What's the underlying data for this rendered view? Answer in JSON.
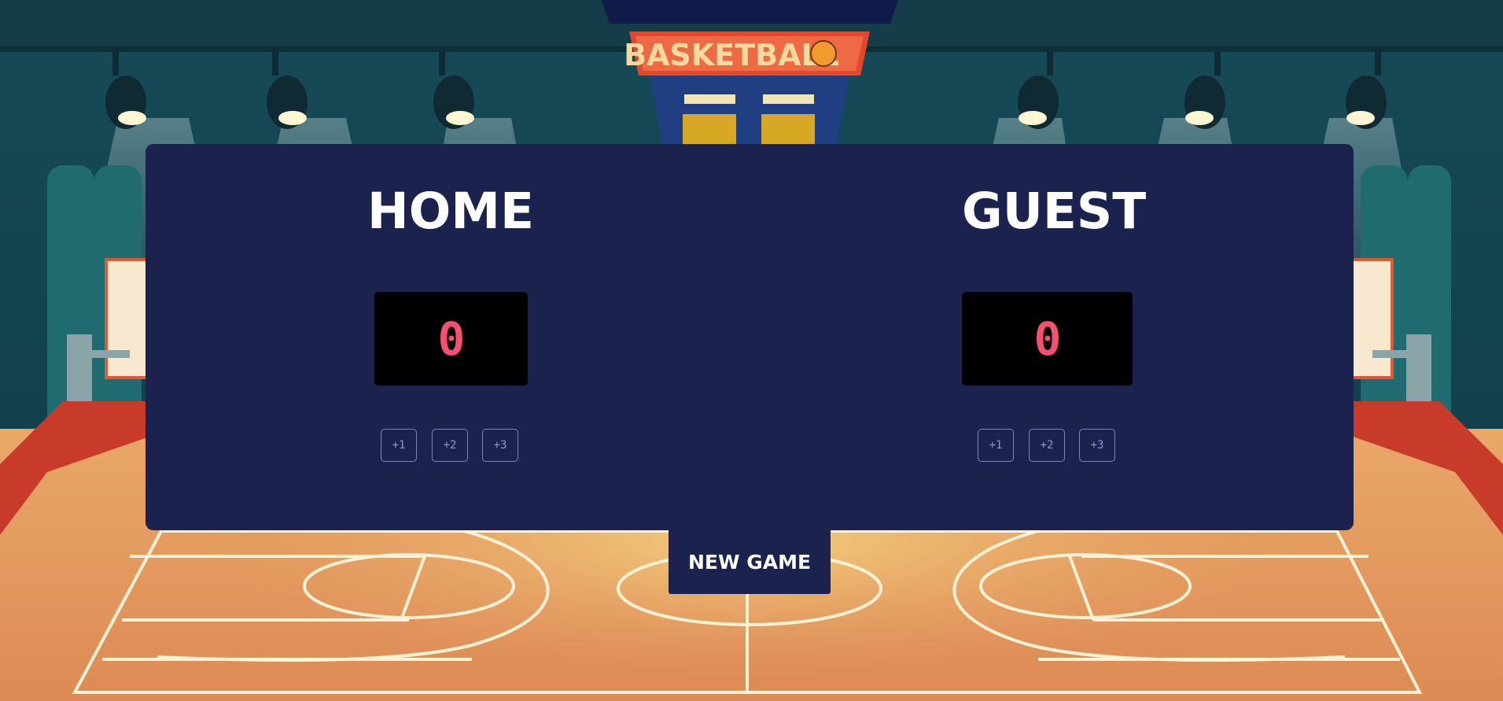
{
  "arena": {
    "banner_text": "BASKETBALL"
  },
  "home": {
    "title": "HOME",
    "score": "0",
    "buttons": [
      "+1",
      "+2",
      "+3"
    ]
  },
  "guest": {
    "title": "GUEST",
    "score": "0",
    "buttons": [
      "+1",
      "+2",
      "+3"
    ]
  },
  "controls": {
    "new_game_label": "NEW GAME"
  },
  "colors": {
    "panel": "#1b224e",
    "score_digits": "#f5506e",
    "score_box": "#000000",
    "button_border": "#7b84b8",
    "court_wood": "#e8a060",
    "banner": "#e2482e"
  }
}
